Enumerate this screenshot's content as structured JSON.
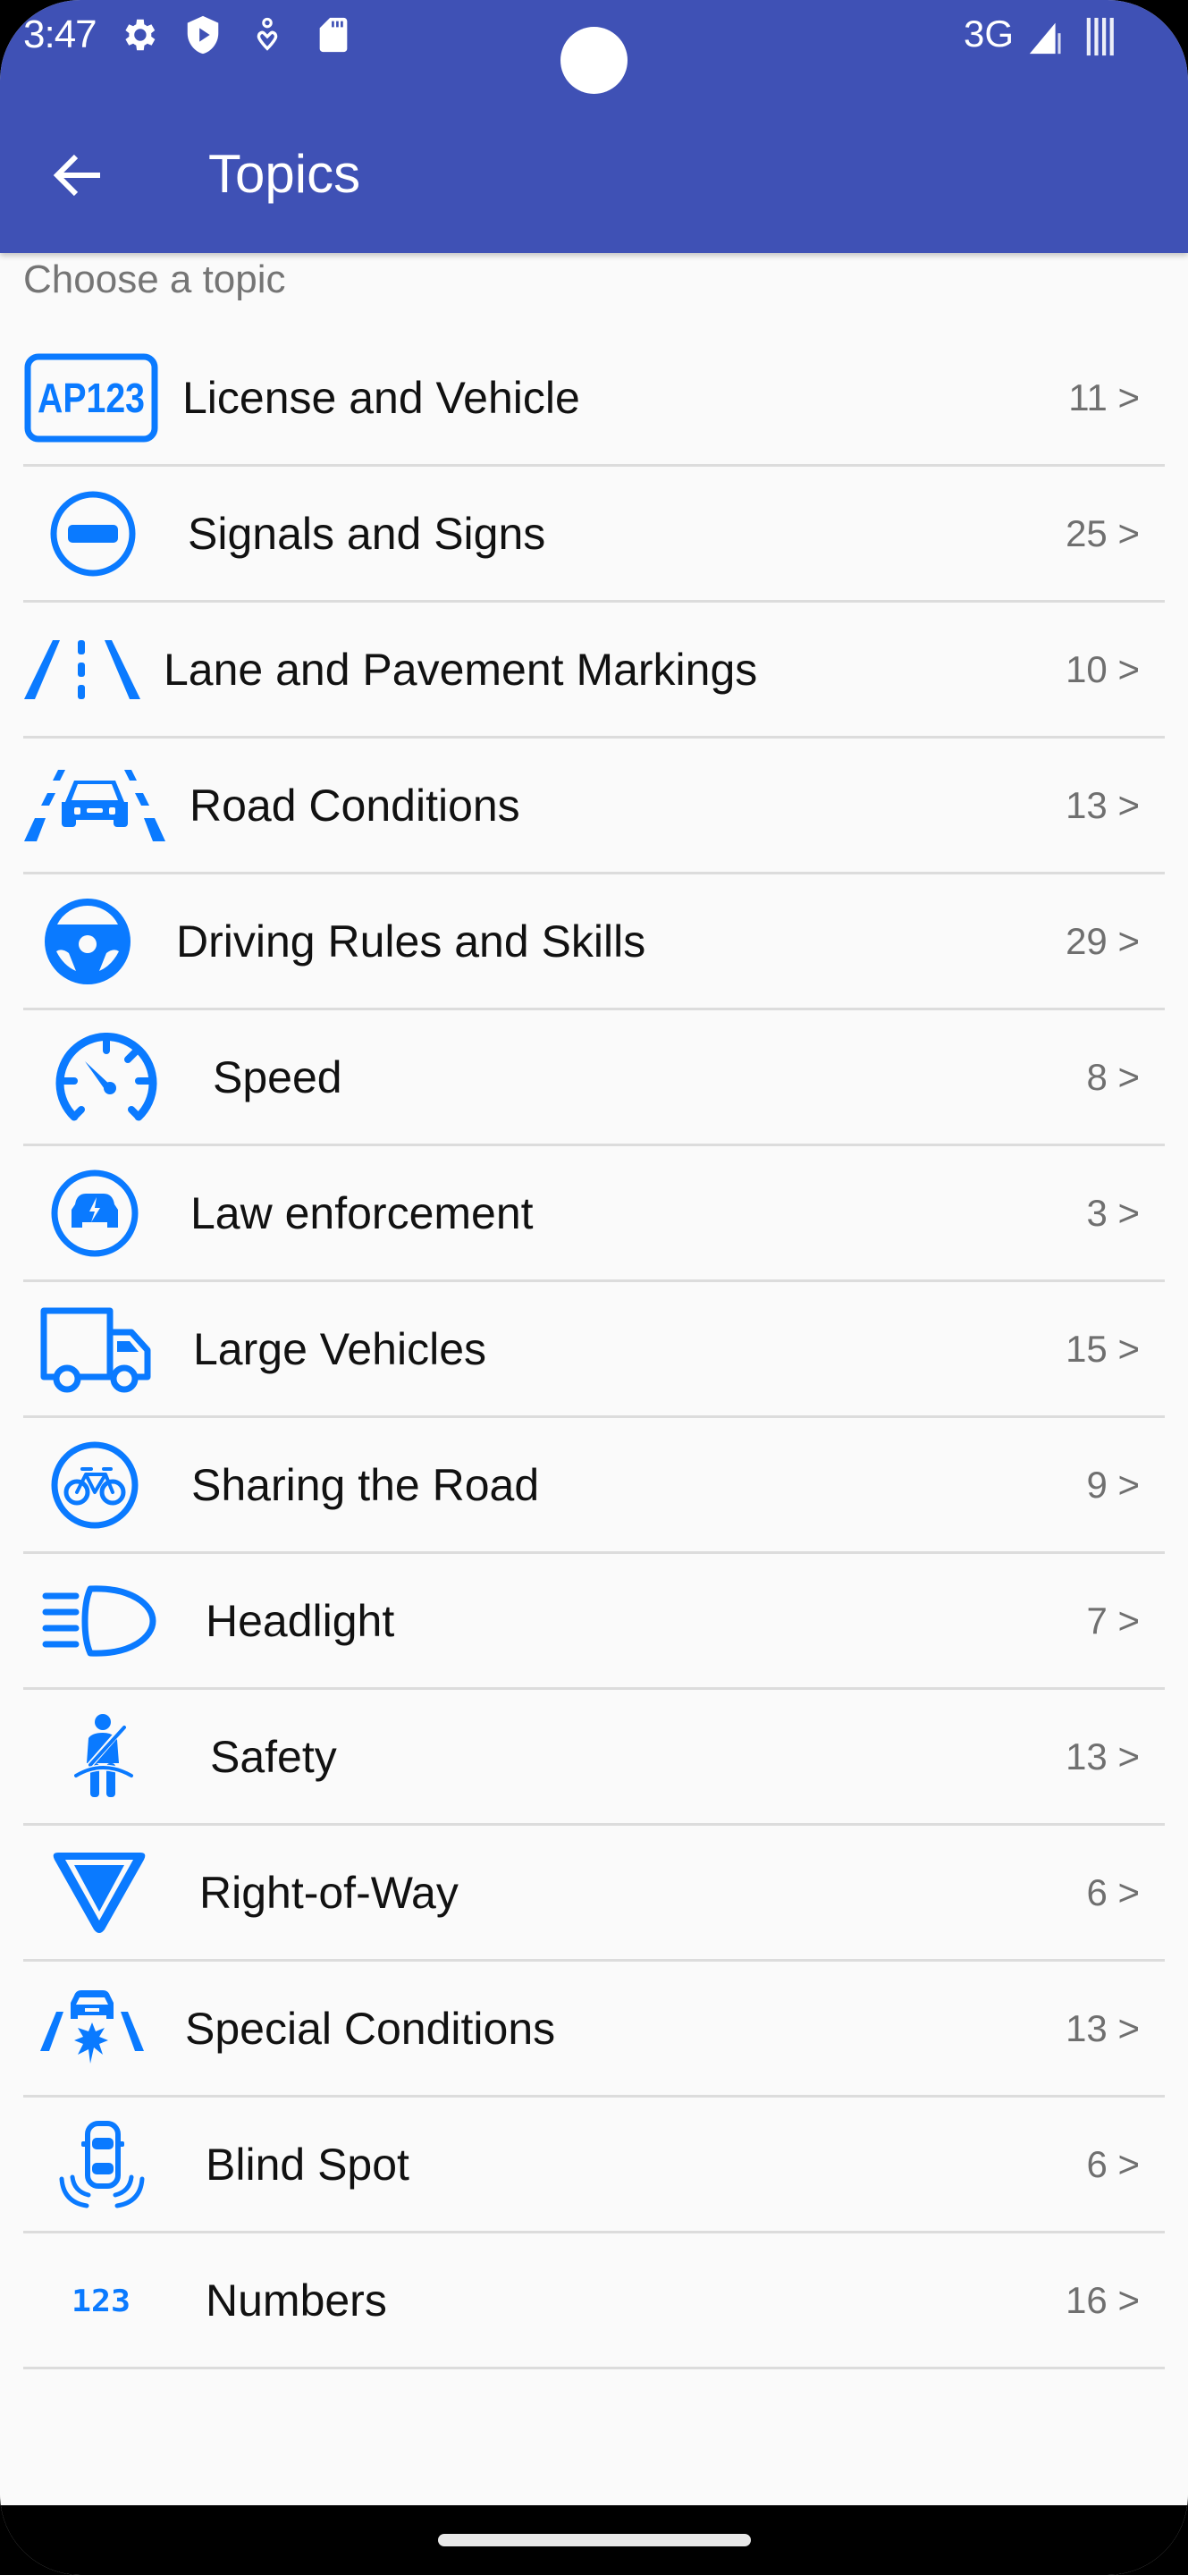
{
  "status_bar": {
    "time": "3:47",
    "left_icons": [
      "gear-icon",
      "shield-play-icon",
      "accessibility-icon",
      "sd-card-icon"
    ],
    "network": "3G",
    "right_icons": [
      "signal-icon",
      "battery-icon"
    ]
  },
  "app_bar": {
    "title": "Topics",
    "back_icon": "arrow-left-icon",
    "background": "#3F51B5"
  },
  "subheader": "Choose a topic",
  "accent_color": "#0A7AFF",
  "topics": [
    {
      "label": "License and Vehicle",
      "count": "11 >",
      "icon": "license-plate-icon"
    },
    {
      "label": "Signals and Signs",
      "count": "25 >",
      "icon": "no-entry-sign-icon"
    },
    {
      "label": "Lane and Pavement Markings",
      "count": "10 >",
      "icon": "lane-markings-icon"
    },
    {
      "label": "Road Conditions",
      "count": "13 >",
      "icon": "car-on-road-icon"
    },
    {
      "label": "Driving Rules and Skills",
      "count": "29 >",
      "icon": "steering-wheel-icon"
    },
    {
      "label": "Speed",
      "count": "8 >",
      "icon": "speedometer-icon"
    },
    {
      "label": "Law enforcement",
      "count": "3 >",
      "icon": "police-car-icon"
    },
    {
      "label": "Large Vehicles",
      "count": "15 >",
      "icon": "truck-icon"
    },
    {
      "label": "Sharing the Road",
      "count": "9 >",
      "icon": "bicycle-icon"
    },
    {
      "label": "Headlight",
      "count": "7 >",
      "icon": "headlight-icon"
    },
    {
      "label": "Safety",
      "count": "13 >",
      "icon": "seatbelt-icon"
    },
    {
      "label": "Right-of-Way",
      "count": "6 >",
      "icon": "yield-sign-icon"
    },
    {
      "label": "Special Conditions",
      "count": "13 >",
      "icon": "car-crash-icon"
    },
    {
      "label": "Blind Spot",
      "count": "6 >",
      "icon": "blind-spot-icon"
    },
    {
      "label": "Numbers",
      "count": "16 >",
      "icon": "numbers-icon"
    }
  ],
  "license_icon_text": "AP123",
  "numbers_icon_text": "123"
}
